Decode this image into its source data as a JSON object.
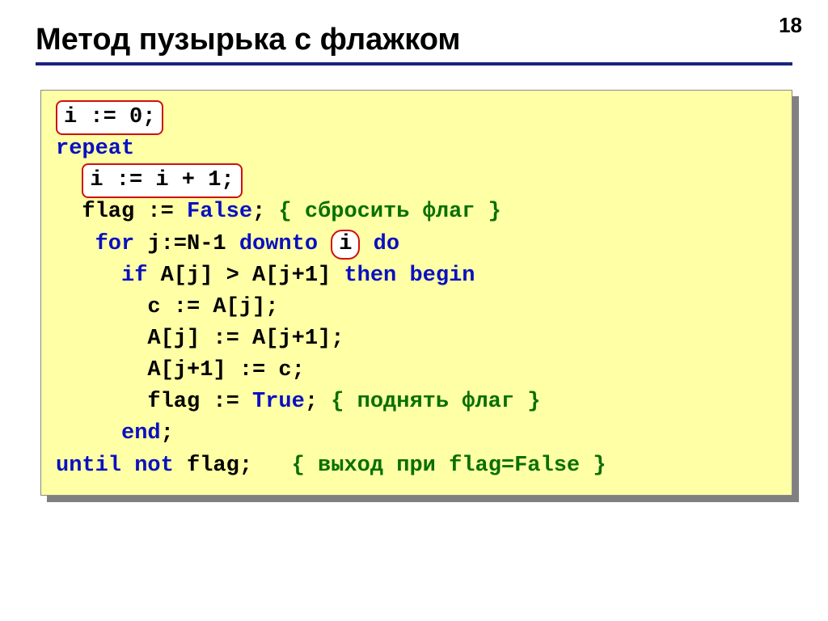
{
  "page_number": "18",
  "title": "Метод пузырька с флажком",
  "code": {
    "l1_boxed": "i := 0;",
    "l2_kw": "repeat",
    "l3_boxed": "i := i + 1;",
    "l4_a": "flag := ",
    "l4_kw": "False",
    "l4_b": "; ",
    "l4_cmt": "{ сбросить флаг }",
    "l5_a_kw": "for",
    "l5_b": " j:=N-1 ",
    "l5_c_kw": "downto",
    "l5_d_sp": " ",
    "l5_circle": "i",
    "l5_e_sp": " ",
    "l5_f_kw": "do",
    "l6_a_kw": "if",
    "l6_b": " A[j] > A[j+1] ",
    "l6_c_kw": "then begin",
    "l7": "с := A[j];",
    "l8": "A[j] := A[j+1];",
    "l9": "A[j+1] := с;",
    "l10_a": "flag := ",
    "l10_kw": "True",
    "l10_b": "; ",
    "l10_cmt": "{ поднять флаг }",
    "l11_kw": "end",
    "l11_b": ";",
    "l12_kw": "until not",
    "l12_b": " flag;   ",
    "l12_cmt": "{ выход при flag=False }"
  }
}
